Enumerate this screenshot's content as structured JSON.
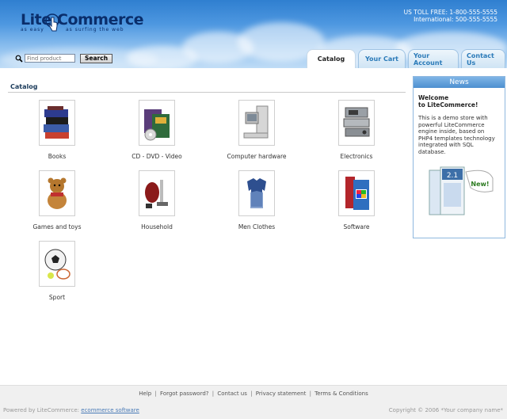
{
  "header": {
    "logo": {
      "word1": "Lite",
      "word2": "Commerce",
      "tagline_left": "as easy",
      "tagline_right": "as surfing the web"
    },
    "contact": {
      "toll_free": "US TOLL FREE: 1-800-555-5555",
      "international": "International: 500-555-5555"
    }
  },
  "search": {
    "placeholder": "Find product",
    "button_label": "Search"
  },
  "tabs": [
    {
      "label": "Catalog",
      "active": true
    },
    {
      "label": "Your Cart",
      "active": false
    },
    {
      "label": "Your Account",
      "active": false
    },
    {
      "label": "Contact Us",
      "active": false
    }
  ],
  "catalog": {
    "title": "Catalog",
    "categories": [
      {
        "label": "Books",
        "icon": "books-icon"
      },
      {
        "label": "CD - DVD - Video",
        "icon": "cd-dvd-icon"
      },
      {
        "label": "Computer hardware",
        "icon": "computer-icon"
      },
      {
        "label": "Electronics",
        "icon": "electronics-icon"
      },
      {
        "label": "Games and toys",
        "icon": "teddy-bear-icon"
      },
      {
        "label": "Household",
        "icon": "vacuum-icon"
      },
      {
        "label": "Men Clothes",
        "icon": "shirts-icon"
      },
      {
        "label": "Software",
        "icon": "software-box-icon"
      },
      {
        "label": "Sport",
        "icon": "sport-balls-icon"
      }
    ]
  },
  "news": {
    "title": "News",
    "welcome_line1": "Welcome",
    "welcome_line2": "to LiteCommerce!",
    "text": "This is a demo store with powerful LiteCommerce engine inside, based on PHP4 templates technology integrated with SQL database.",
    "box_version": "2.1",
    "badge": "New!"
  },
  "footer": {
    "links": [
      "Help",
      "Forgot password?",
      "Contact us",
      "Privacy statement",
      "Terms & Conditions"
    ],
    "powered_prefix": "Powered by LiteCommerce:",
    "powered_link": "ecommerce software",
    "copyright": "Copyright © 2006 *Your company name*"
  },
  "colors": {
    "header_blue": "#2f7fd0",
    "tab_text": "#2a7ab8",
    "news_header": "#4d8fd0"
  }
}
